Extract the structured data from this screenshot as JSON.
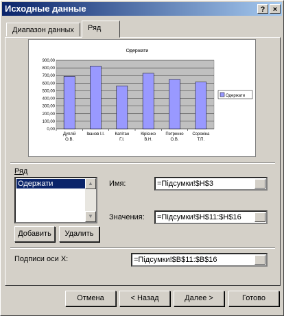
{
  "window": {
    "title": "Исходные данные",
    "help_label": "?",
    "close_label": "×"
  },
  "tabs": [
    {
      "label": "Диапазон данных"
    },
    {
      "label": "Ряд"
    }
  ],
  "chart_data": {
    "type": "bar",
    "title": "Одержати",
    "categories": [
      "Дуплій О.В.",
      "Іванов І.І.",
      "Капітан Г.І.",
      "Кірієнко В.Н.",
      "Петренко О.В.",
      "Сорокіна Т.П."
    ],
    "category_lines": [
      [
        "Дуплій",
        "О.В."
      ],
      [
        "Іванов І.І.",
        ""
      ],
      [
        "Капітан",
        "Г.І."
      ],
      [
        "Кірієнко",
        "В.Н."
      ],
      [
        "Петренко",
        "О.В."
      ],
      [
        "Сорокіна",
        "Т.П."
      ]
    ],
    "series": [
      {
        "name": "Одержати",
        "values": [
          690,
          825,
          565,
          730,
          650,
          615
        ]
      }
    ],
    "yticks": [
      "0,00",
      "100,00",
      "200,00",
      "300,00",
      "400,00",
      "500,00",
      "600,00",
      "700,00",
      "800,00",
      "900,00"
    ],
    "ylim": [
      0,
      900
    ],
    "grid": true,
    "legend_position": "right",
    "colors": {
      "bar": "#9999ff",
      "plot_bg": "#c0c0c0"
    }
  },
  "series_group": {
    "label": "Ряд",
    "items": [
      "Одержати"
    ]
  },
  "buttons": {
    "add": "Добавить",
    "delete": "Удалить"
  },
  "fields": {
    "name_label": "Имя:",
    "name_value": "=Підсумки!$H$3",
    "values_label": "Значения:",
    "values_value": "=Підсумки!$H$11:$H$16",
    "xaxis_label": "Подписи оси X:",
    "xaxis_value": "=Підсумки!$B$11:$B$16"
  },
  "footer": {
    "cancel": "Отмена",
    "back": "< Назад",
    "next": "Далее >",
    "finish": "Готово"
  }
}
